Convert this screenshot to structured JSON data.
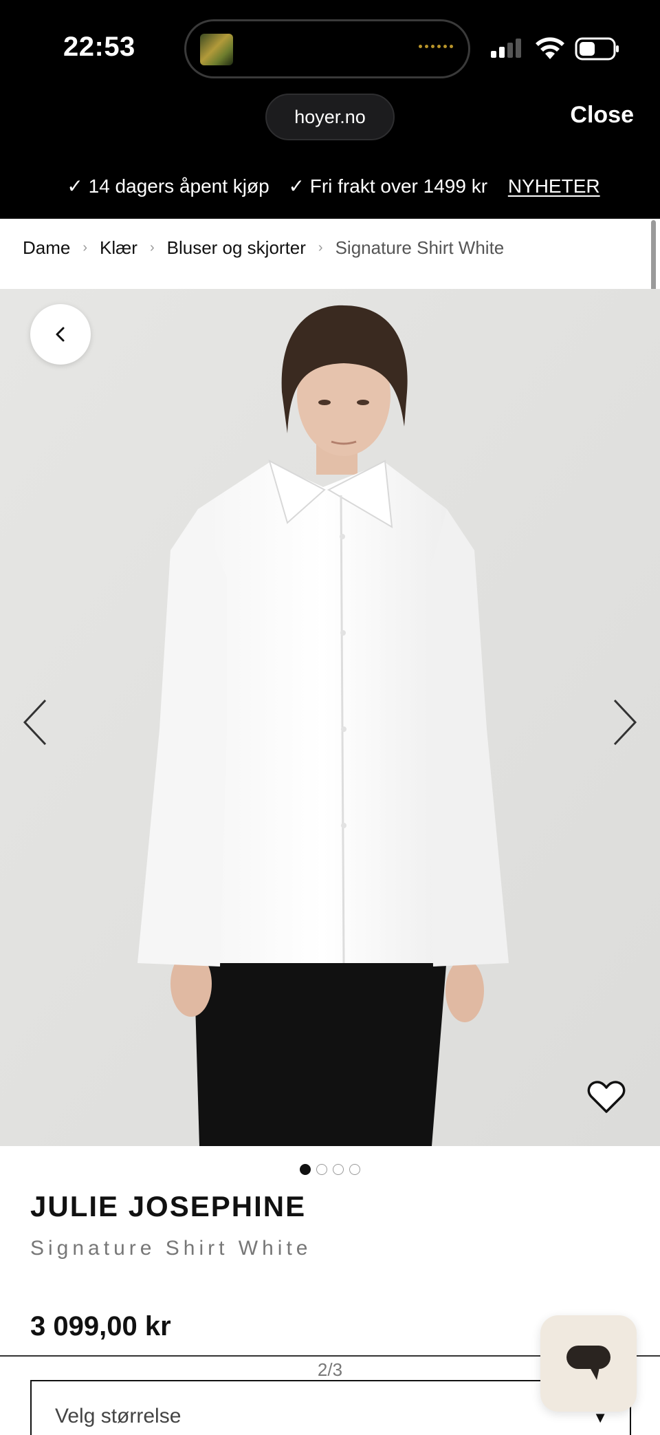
{
  "status_bar": {
    "time": "22:53"
  },
  "browser": {
    "url": "hoyer.no",
    "close_label": "Close"
  },
  "promo": {
    "item1": "✓ 14 dagers åpent kjøp",
    "item2": "✓ Fri frakt over 1499 kr",
    "link": "NYHETER"
  },
  "breadcrumb": [
    "Dame",
    "Klær",
    "Bluser og skjorter",
    "Signature Shirt White"
  ],
  "gallery": {
    "count": 4,
    "active_index": 0
  },
  "product": {
    "brand": "JULIE JOSEPHINE",
    "name": "Signature Shirt White",
    "price": "3 099,00 kr"
  },
  "pager": "2/3",
  "size_select": {
    "label": "Velg størrelse",
    "caret": "▼"
  },
  "icons": {
    "back": "chevron-left-icon",
    "prev": "chevron-left-icon",
    "next": "chevron-right-icon",
    "favorite": "heart-icon",
    "chat": "chat-bubble-icon"
  },
  "colors": {
    "chrome": "#000000",
    "hero_bg": "#e4e4e2",
    "chat_bg": "#f0e9df"
  }
}
